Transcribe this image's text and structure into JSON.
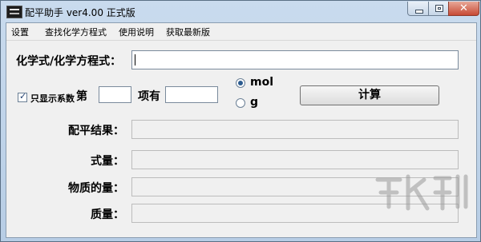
{
  "window": {
    "title": "配平助手 ver4.00 正式版",
    "close_glyph": "✕"
  },
  "menu": [
    "设置",
    "查找化学方程式",
    "使用说明",
    "获取最新版"
  ],
  "formula": {
    "label": "化学式/化学方程式：",
    "value": ""
  },
  "coef": {
    "checkbox_label": "只显示系数",
    "checked": true,
    "prefix": "第",
    "suffix": "项有",
    "index_value": "",
    "amount_value": ""
  },
  "unit": {
    "options": [
      "mol",
      "g"
    ],
    "selected": "mol"
  },
  "calc_button": "计算",
  "results": {
    "balance_label": "配平结果：",
    "formula_mass_label": "式量：",
    "amount_label": "物质的量：",
    "mass_label": "质量："
  },
  "colors": {
    "title_bar": "#c3d7ec",
    "close_button": "#c74a35",
    "radio_accent": "#2a5a8f"
  }
}
